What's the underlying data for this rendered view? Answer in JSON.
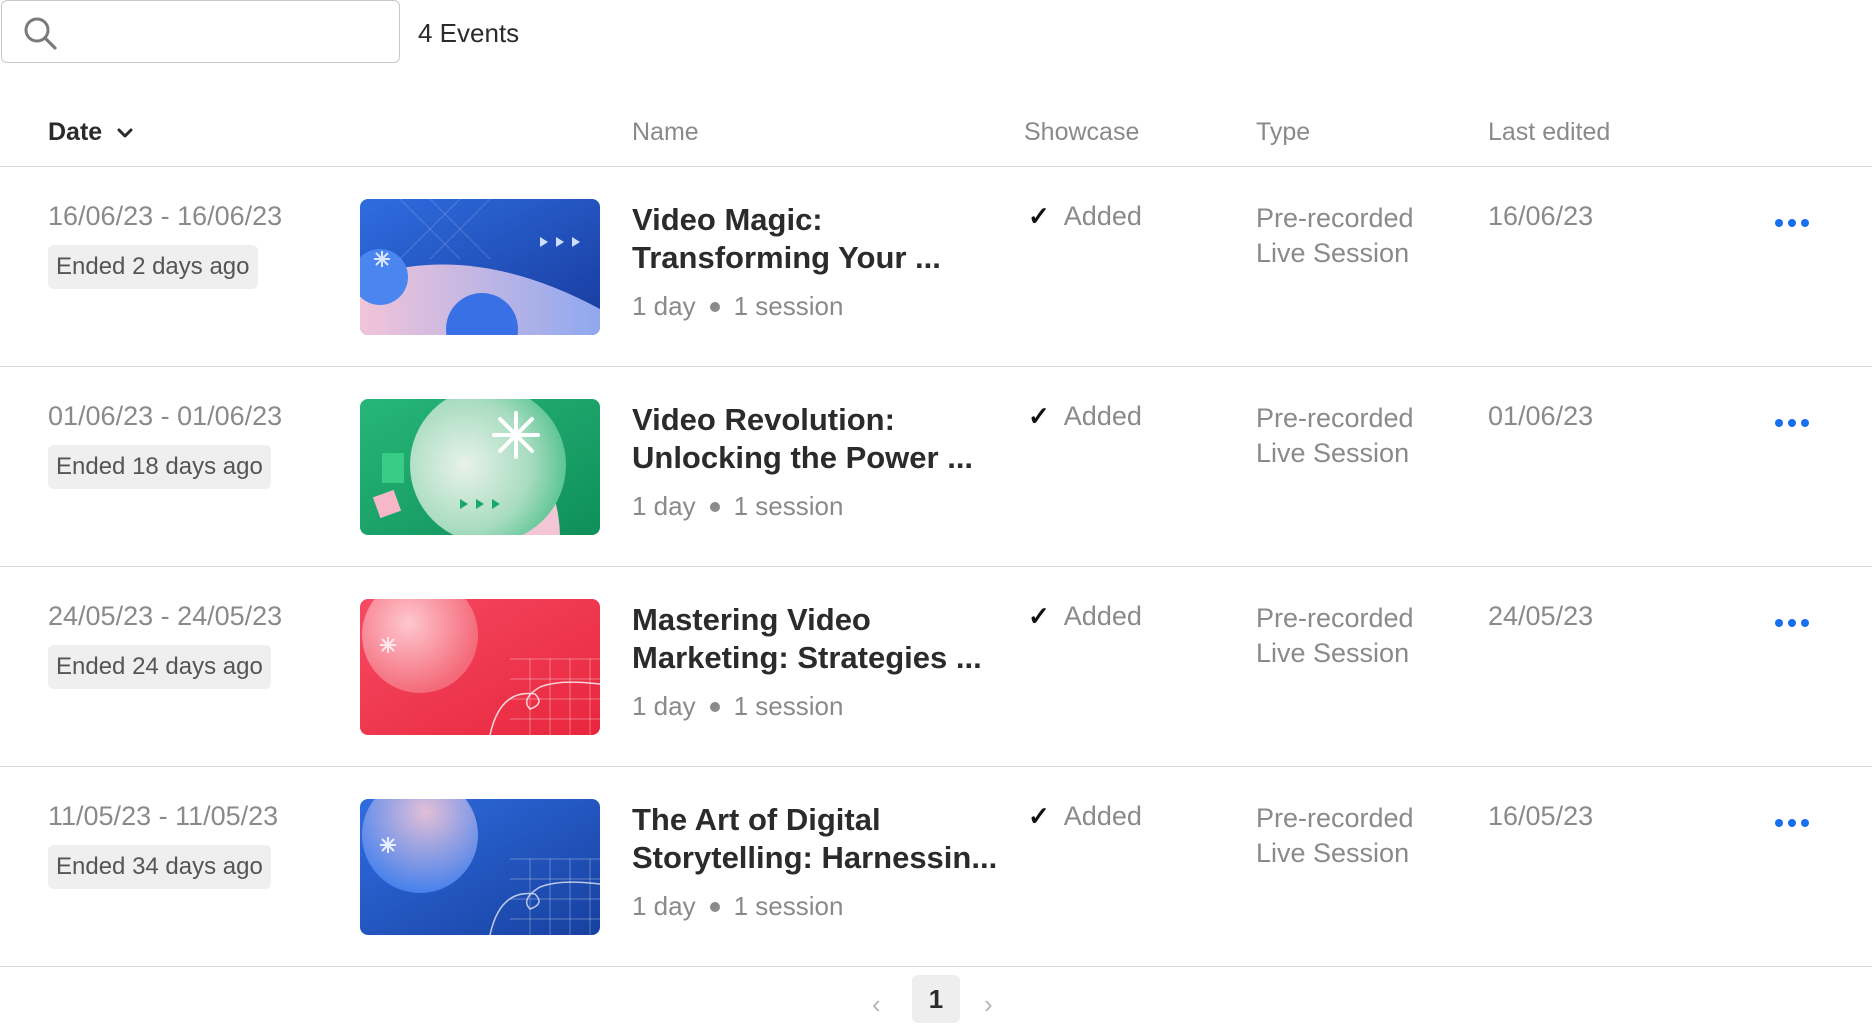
{
  "toolbar": {
    "search_placeholder": "",
    "events_count": "4 Events"
  },
  "table": {
    "columns": {
      "date": "Date",
      "name": "Name",
      "showcase": "Showcase",
      "type": "Type",
      "last_edited": "Last edited"
    },
    "rows": [
      {
        "date_range": "16/06/23 - 16/06/23",
        "status": "Ended 2 days ago",
        "title_line1": "Video Magic:",
        "title_line2": "Transforming Your ...",
        "days": "1 day",
        "sessions": "1 session",
        "showcase": "Added",
        "type_line1": "Pre-recorded",
        "type_line2": "Live Session",
        "last_edited": "16/06/23",
        "thumb_theme": "blue-waves"
      },
      {
        "date_range": "01/06/23 - 01/06/23",
        "status": "Ended 18 days ago",
        "title_line1": "Video Revolution:",
        "title_line2": "Unlocking the Power ...",
        "days": "1 day",
        "sessions": "1 session",
        "showcase": "Added",
        "type_line1": "Pre-recorded",
        "type_line2": "Live Session",
        "last_edited": "01/06/23",
        "thumb_theme": "green-sphere"
      },
      {
        "date_range": "24/05/23 - 24/05/23",
        "status": "Ended 24 days ago",
        "title_line1": "Mastering Video",
        "title_line2": "Marketing: Strategies ...",
        "days": "1 day",
        "sessions": "1 session",
        "showcase": "Added",
        "type_line1": "Pre-recorded",
        "type_line2": "Live Session",
        "last_edited": "24/05/23",
        "thumb_theme": "red-grid"
      },
      {
        "date_range": "11/05/23 - 11/05/23",
        "status": "Ended 34 days ago",
        "title_line1": "The Art of Digital",
        "title_line2": "Storytelling: Harnessin...",
        "days": "1 day",
        "sessions": "1 session",
        "showcase": "Added",
        "type_line1": "Pre-recorded",
        "type_line2": "Live Session",
        "last_edited": "16/05/23",
        "thumb_theme": "blue-grid"
      }
    ]
  },
  "pagination": {
    "current_page": "1"
  },
  "colors": {
    "accent": "#1a6ff0",
    "muted_text": "#8a8a8a",
    "divider": "#d6d6d6"
  }
}
